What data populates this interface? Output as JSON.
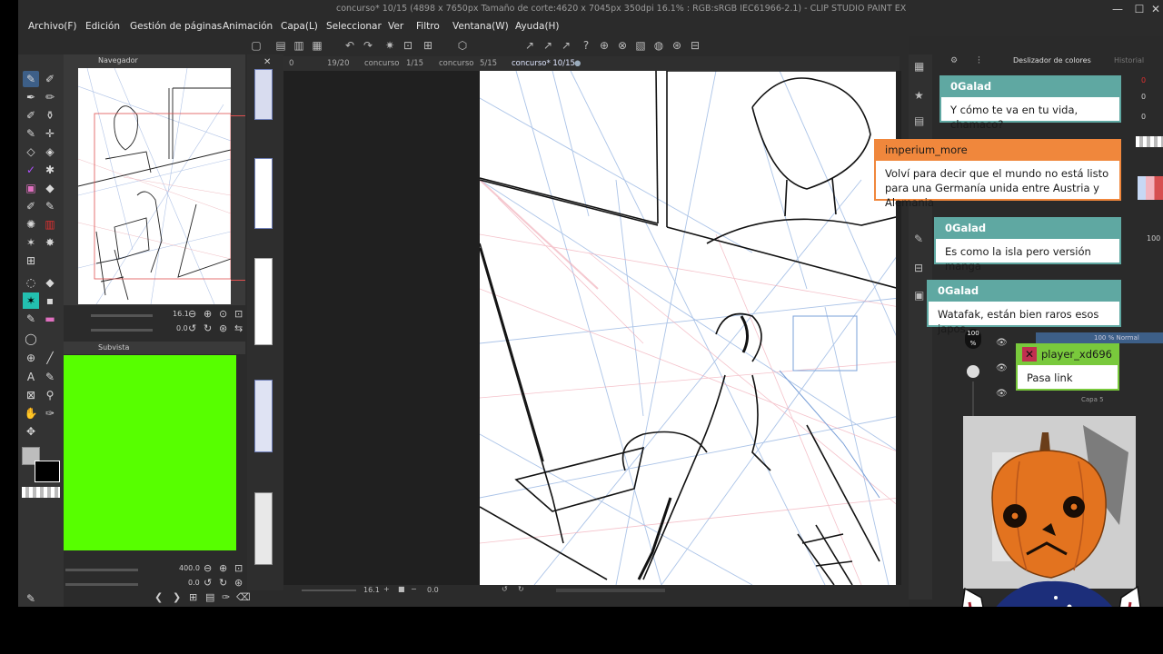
{
  "window": {
    "title": "concurso* 10/15 (4898 x 7650px Tamaño de corte:4620 x 7045px 350dpi 16.1% : RGB:sRGB IEC61966-2.1)  - CLIP STUDIO PAINT EX",
    "minimize": "—",
    "maximize": "☐",
    "close": "✕"
  },
  "menu": [
    "Archivo(F)",
    "Edición",
    "Gestión de páginas",
    "Animación",
    "Capa(L)",
    "Seleccionar",
    "Ver",
    "Filtro",
    "Ventana(W)",
    "Ayuda(H)"
  ],
  "navigator": {
    "title": "Navegador",
    "zoom": "16.1",
    "angle": "0.0"
  },
  "subview": {
    "title": "Subvista",
    "zoom": "400.0",
    "angle": "0.0",
    "fill_color": "#57ff00"
  },
  "tabs": [
    {
      "num": "0",
      "name": ""
    },
    {
      "num": "19/20",
      "name": "concurso"
    },
    {
      "num": "1/15",
      "name": "concurso"
    },
    {
      "num": "5/15",
      "name": "concurso* 10/15"
    }
  ],
  "canvas_status": {
    "zoom": "16.1",
    "angle": "0.0"
  },
  "right_panel": {
    "color_slider_title": "Deslizador de colores",
    "history_title": "Historial",
    "rgb_values": [
      "0",
      "0",
      "0"
    ],
    "opacity": "100",
    "layer_mode": "100 % Normal",
    "layer_name": "Capa 5",
    "brush_size_label": "100 %"
  },
  "chat": [
    {
      "user": "0Galad",
      "text": "Y cómo te va en tu vida, chamaco?",
      "style": "teal"
    },
    {
      "user": "imperium_more",
      "text": "Volví para decir que el mundo no está listo para una Germanía unida entre Austria y Alemania",
      "style": "orange"
    },
    {
      "user": "0Galad",
      "text": "Es como la isla pero versión manga",
      "style": "teal"
    },
    {
      "user": "0Galad",
      "text": "Watafak, están bien raros esos japos",
      "style": "teal"
    },
    {
      "user": "player_xd696",
      "text": "Pasa link",
      "style": "green"
    }
  ],
  "colors": {
    "chat_teal": "#5fa8a2",
    "chat_orange": "#f0873c",
    "chat_green": "#79c93c",
    "accent": "#3d5f88"
  }
}
